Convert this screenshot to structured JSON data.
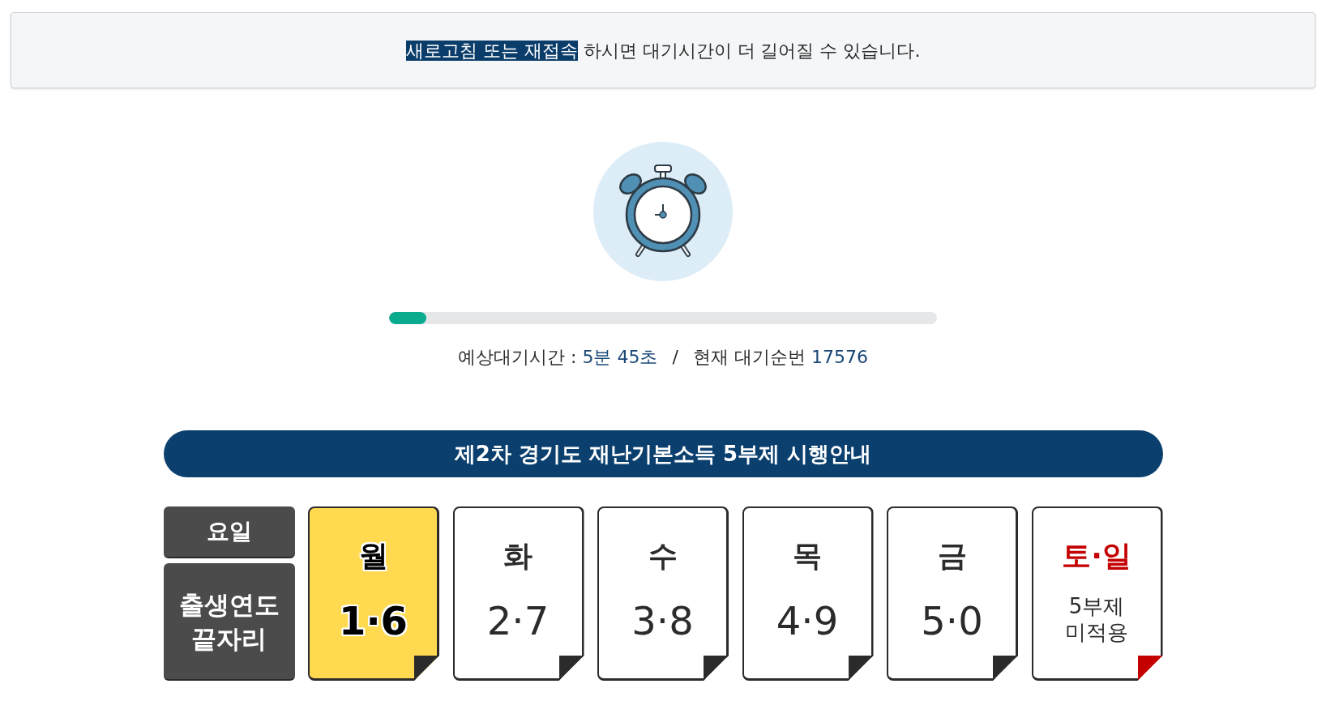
{
  "notice": {
    "highlight": "새로고침 또는 재접속",
    "text": "하시면 대기시간이 더 길어질 수 있습니다."
  },
  "wait": {
    "level": 0.068,
    "time_label": "예상대기시간 :",
    "time_value": "5분 45초",
    "separator": "/",
    "order_label": "현재 대기순번",
    "order_value": "17576"
  },
  "schedule": {
    "title": "제2차 경기도 재난기본소득 5부제 시행안내",
    "header_day": "요일",
    "header_digits": "출생연도 끝자리",
    "days": [
      {
        "day": "월",
        "kind": "digits",
        "value": "1·6",
        "selected": true
      },
      {
        "day": "화",
        "kind": "digits",
        "value": "2·7",
        "selected": false
      },
      {
        "day": "수",
        "kind": "digits",
        "value": "3·8",
        "selected": false
      },
      {
        "day": "목",
        "kind": "digits",
        "value": "4·9",
        "selected": false
      },
      {
        "day": "금",
        "kind": "digits",
        "value": "5·0",
        "selected": false
      },
      {
        "day": "토·일",
        "kind": "exempt",
        "value": "5부제 미적용",
        "selected": false
      }
    ]
  }
}
